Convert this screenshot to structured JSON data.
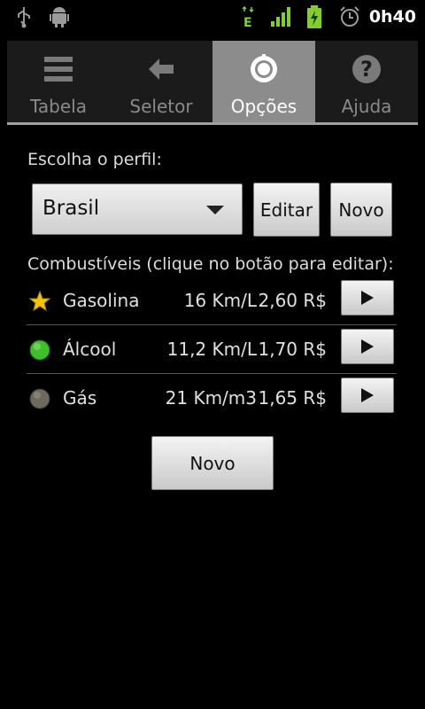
{
  "status_bar": {
    "time": "0h40",
    "icons": [
      "usb-icon",
      "android-debug-icon",
      "data-e-icon",
      "signal-icon",
      "battery-charging-icon",
      "alarm-icon"
    ]
  },
  "tabs": [
    {
      "label": "Tabela",
      "icon": "list-icon",
      "active": false
    },
    {
      "label": "Seletor",
      "icon": "back-arrow-icon",
      "active": false
    },
    {
      "label": "Opções",
      "icon": "settings-icon",
      "active": true
    },
    {
      "label": "Ajuda",
      "icon": "help-icon",
      "active": false
    }
  ],
  "profile": {
    "label": "Escolha o perfil:",
    "selected": "Brasil",
    "edit_label": "Editar",
    "new_label": "Novo"
  },
  "fuels": {
    "label": "Combustíveis (clique no botão para editar):",
    "items": [
      {
        "name": "Gasolina",
        "efficiency": "16 Km/L",
        "price": "2,60 R$",
        "icon": "star-icon"
      },
      {
        "name": "Álcool",
        "efficiency": "11,2 Km/L",
        "price": "1,70 R$",
        "icon": "green-dot-icon"
      },
      {
        "name": "Gás",
        "efficiency": "21 Km/m3",
        "price": "1,65 R$",
        "icon": "gray-dot-icon"
      }
    ],
    "new_label": "Novo"
  },
  "colors": {
    "active_tab": "#8c8c8c",
    "background": "#000000",
    "signal_green": "#7fd12a"
  }
}
